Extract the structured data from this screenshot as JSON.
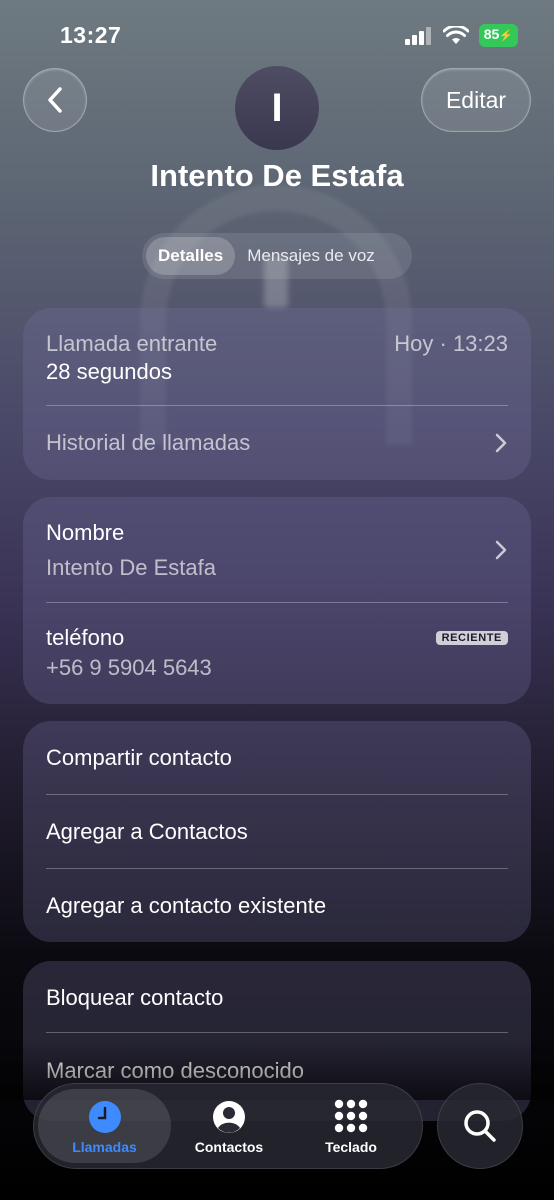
{
  "status_bar": {
    "time": "13:27",
    "battery": "85"
  },
  "header": {
    "edit_label": "Editar",
    "avatar_initial": "I",
    "contact_name": "Intento De Estafa"
  },
  "segments": {
    "details": "Detalles",
    "voicemail": "Mensajes de voz"
  },
  "call_card": {
    "type": "Llamada entrante",
    "time": "Hoy · 13:23",
    "duration": "28 segundos",
    "history_label": "Historial de llamadas"
  },
  "info_card": {
    "name_label": "Nombre",
    "name_value": "Intento De Estafa",
    "phone_label": "teléfono",
    "phone_badge": "RECIENTE",
    "phone_value": "+56 9 5904 5643"
  },
  "actions_card": {
    "share": "Compartir contacto",
    "add": "Agregar a Contactos",
    "add_existing": "Agregar a contacto existente"
  },
  "block_card": {
    "block": "Bloquear contacto",
    "mark_unknown": "Marcar como desconocido"
  },
  "tabbar": {
    "calls": "Llamadas",
    "contacts": "Contactos",
    "keypad": "Teclado"
  },
  "colors": {
    "accent": "#3d8bff",
    "battery": "#34c759"
  }
}
